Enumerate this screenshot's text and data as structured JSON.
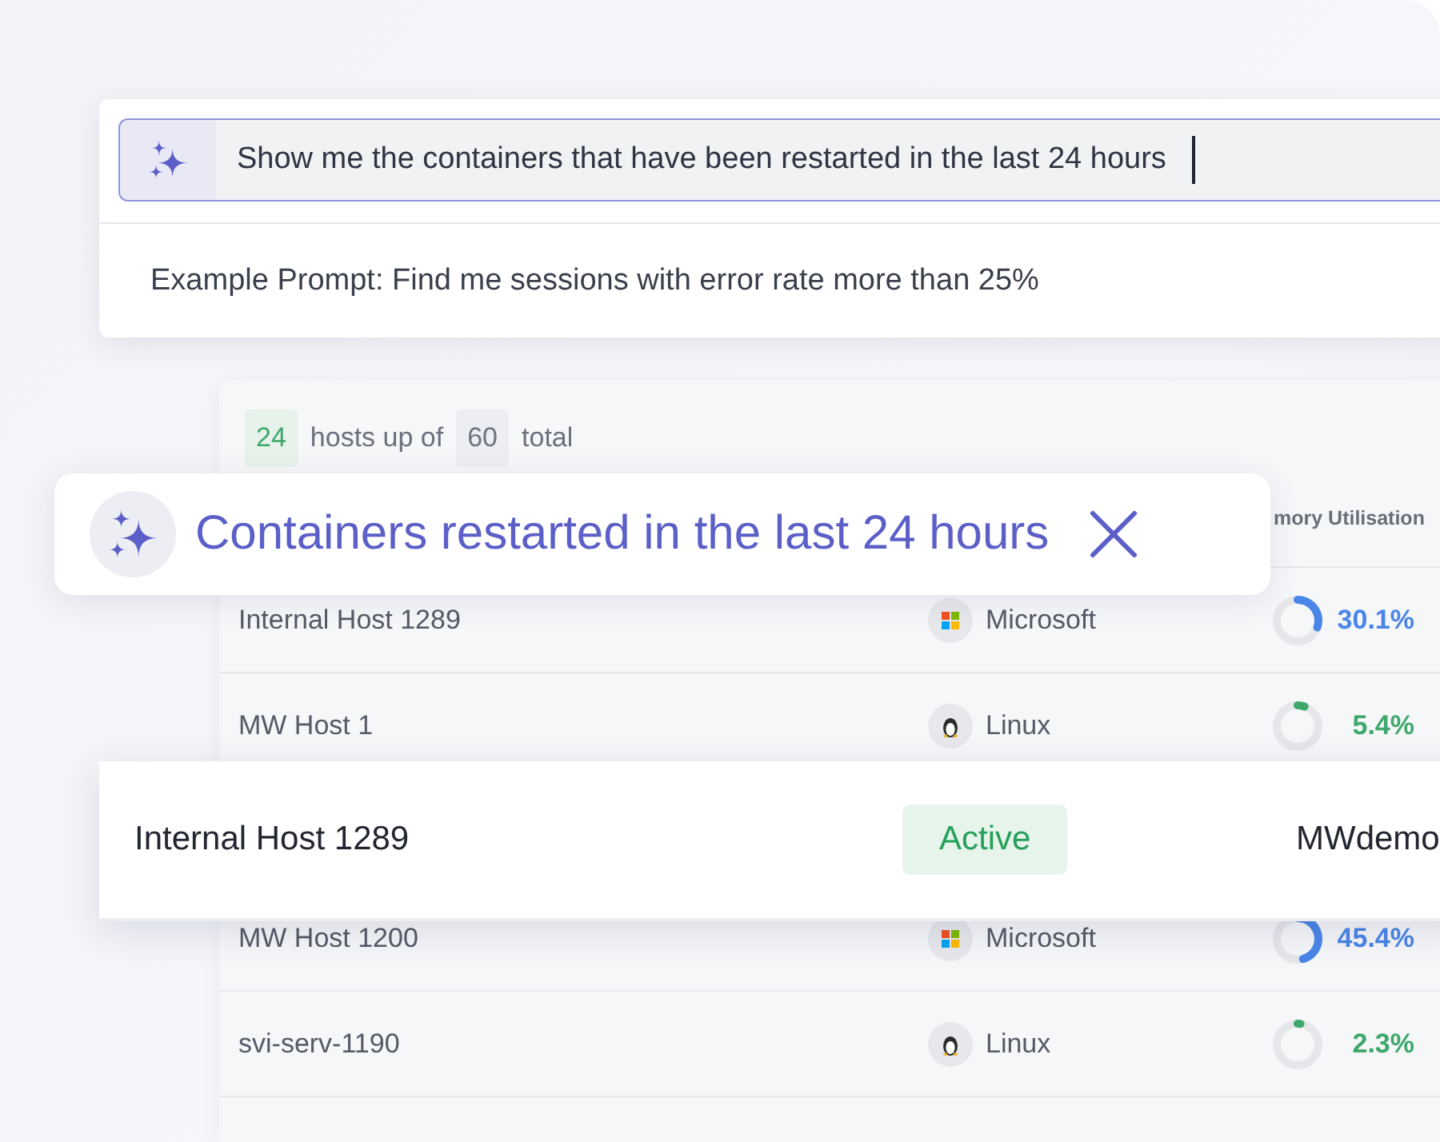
{
  "prompt": {
    "query": "Show me the containers that have been restarted in the last 24 hours",
    "example": "Example Prompt: Find me sessions with error rate more than 25%"
  },
  "summary": {
    "up": "24",
    "text_1": "hosts up of",
    "total": "60",
    "text_2": "total"
  },
  "table": {
    "header": "mory Utilisation",
    "rows": [
      {
        "name": "Internal Host 1289",
        "os": {
          "kind": "windows",
          "label": "Microsoft"
        },
        "memory": {
          "level": 0.301,
          "reading": "30.1%",
          "color": "#4a86e8"
        }
      },
      {
        "name": "MW Host 1",
        "os": {
          "kind": "linux",
          "label": "Linux"
        },
        "memory": {
          "level": 0.054,
          "reading": "5.4%",
          "color": "#3fa86b"
        }
      },
      {
        "name": "MW Host 1200",
        "os": {
          "kind": "windows",
          "label": "Microsoft"
        },
        "memory": {
          "level": 0.454,
          "reading": "45.4%",
          "color": "#4a86e8"
        }
      },
      {
        "name": "svi-serv-1190",
        "os": {
          "kind": "linux",
          "label": "Linux"
        },
        "memory": {
          "level": 0.023,
          "reading": "2.3%",
          "color": "#3fa86b"
        }
      }
    ]
  },
  "filter_chip": {
    "label": "Containers restarted in the last 24 hours"
  },
  "highlight": {
    "name": "Internal Host 1289",
    "status": {
      "kind": "active",
      "label": "Active"
    },
    "user": "MWdemo"
  }
}
